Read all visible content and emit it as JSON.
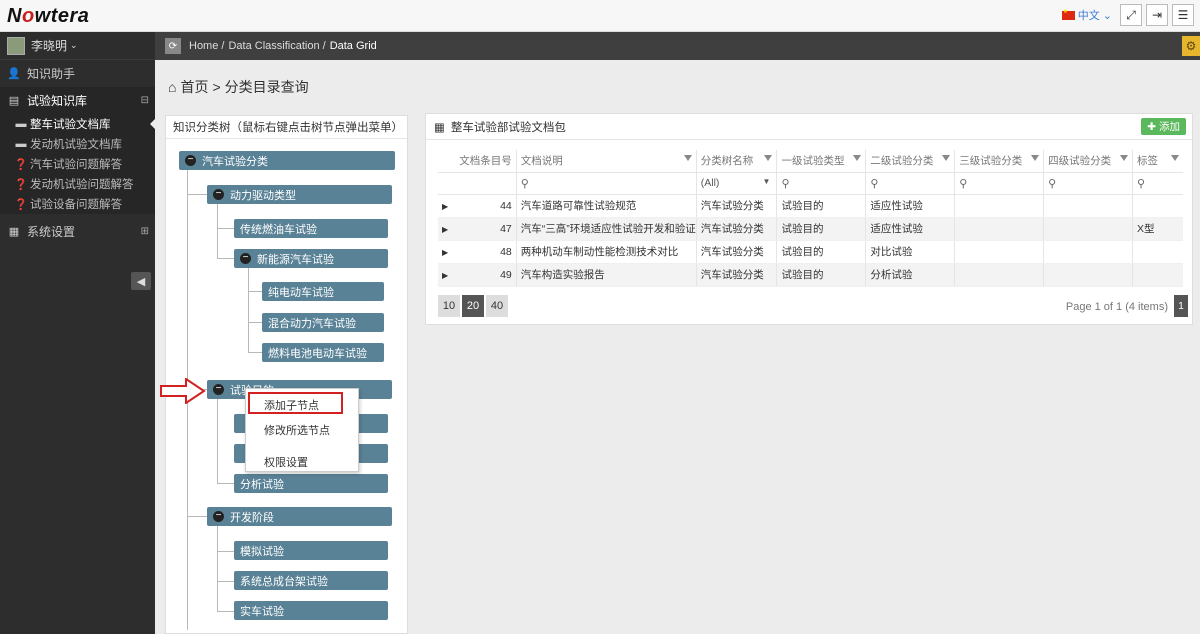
{
  "brand": {
    "logo_prefix": "N",
    "logo_o": "o",
    "logo_suffix": "wtera"
  },
  "topbar": {
    "language": "中文",
    "fullscreen_icon": "fullscreen-icon",
    "logout_icon": "logout-icon",
    "menu_icon": "menu-icon"
  },
  "user": {
    "name": "李晓明"
  },
  "sidebar": {
    "items": [
      {
        "label": "知识助手",
        "icon": "user-icon"
      },
      {
        "label": "试验知识库",
        "icon": "list-icon",
        "toggle": "⊟"
      },
      {
        "label": "系统设置",
        "icon": "building-icon",
        "toggle": "⊞"
      }
    ],
    "sub_items": [
      {
        "label": "整车试验文档库",
        "icon": "inbox-icon"
      },
      {
        "label": "发动机试验文档库",
        "icon": "inbox-icon"
      },
      {
        "label": "汽车试验问题解答",
        "icon": "question-icon"
      },
      {
        "label": "发动机试验问题解答",
        "icon": "question-icon"
      },
      {
        "label": "试验设备问题解答",
        "icon": "question-icon"
      }
    ]
  },
  "breadcrumb": {
    "home": "Home /",
    "level1": "Data Classification /",
    "current": "Data Grid"
  },
  "page_title": {
    "home": "首页",
    "sep": ">",
    "title": "分类目录查询"
  },
  "tree_panel": {
    "header": "知识分类树（鼠标右键点击树节点弹出菜单）",
    "nodes": {
      "root": "汽车试验分类",
      "power": "动力驱动类型",
      "fuel": "传统燃油车试验",
      "nev": "新能源汽车试验",
      "ev": "纯电动车试验",
      "hybrid": "混合动力汽车试验",
      "fcell": "燃料电池电动车试验",
      "purpose": "试验目的",
      "analysis": "分析试验",
      "dev": "开发阶段",
      "sim": "模拟试验",
      "bench": "系统总成台架试验",
      "vehicle": "实车试验"
    },
    "context_menu": [
      "添加子节点",
      "修改所选节点",
      "权限设置"
    ]
  },
  "grid_panel": {
    "title": "整车试验部试验文档包",
    "add_label": "添加",
    "columns": [
      "文档条目号",
      "文档说明",
      "分类树名称",
      "一级试验类型",
      "二级试验分类",
      "三级试验分类",
      "四级试验分类",
      "标签"
    ],
    "filter_select": "(All)",
    "rows": [
      {
        "id": "44",
        "desc": "汽车道路可靠性试验规范",
        "tree": "汽车试验分类",
        "l1": "试验目的",
        "l2": "适应性试验",
        "l3": "",
        "l4": "",
        "tag": ""
      },
      {
        "id": "47",
        "desc": "汽车“三高”环境适应性试验开发和验证",
        "tree": "汽车试验分类",
        "l1": "试验目的",
        "l2": "适应性试验",
        "l3": "",
        "l4": "",
        "tag": "X型"
      },
      {
        "id": "48",
        "desc": "两种机动车制动性能检测技术对比",
        "tree": "汽车试验分类",
        "l1": "试验目的",
        "l2": "对比试验",
        "l3": "",
        "l4": "",
        "tag": ""
      },
      {
        "id": "49",
        "desc": "汽车构造实验报告",
        "tree": "汽车试验分类",
        "l1": "试验目的",
        "l2": "分析试验",
        "l3": "",
        "l4": "",
        "tag": ""
      }
    ],
    "page_sizes": [
      "10",
      "20",
      "40"
    ],
    "selected_page_size": "20",
    "page_info": "Page 1 of 1 (4 items)",
    "current_page": "1"
  }
}
